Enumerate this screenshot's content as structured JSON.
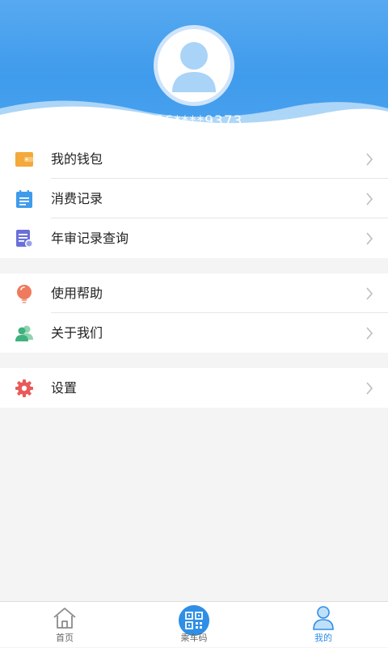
{
  "profile": {
    "phone": "156****9373"
  },
  "menu": {
    "group1": [
      {
        "label": "我的钱包",
        "icon": "wallet-icon",
        "color": "#f3a93b"
      },
      {
        "label": "消费记录",
        "icon": "record-list-icon",
        "color": "#3f9bec"
      },
      {
        "label": "年审记录查询",
        "icon": "document-search-icon",
        "color": "#6a70d9"
      }
    ],
    "group2": [
      {
        "label": "使用帮助",
        "icon": "lightbulb-icon",
        "color": "#ef7a5e"
      },
      {
        "label": "关于我们",
        "icon": "users-icon",
        "color": "#3fb27f"
      }
    ],
    "group3": [
      {
        "label": "设置",
        "icon": "gear-icon",
        "color": "#e95a5a"
      }
    ]
  },
  "tabs": [
    {
      "label": "首页",
      "icon": "home-icon"
    },
    {
      "label": "乘车码",
      "icon": "qr-code-icon"
    },
    {
      "label": "我的",
      "icon": "person-icon",
      "active": true
    }
  ],
  "colors": {
    "header_blue": "#3f9bec",
    "active_tab": "#2f8ee6"
  }
}
